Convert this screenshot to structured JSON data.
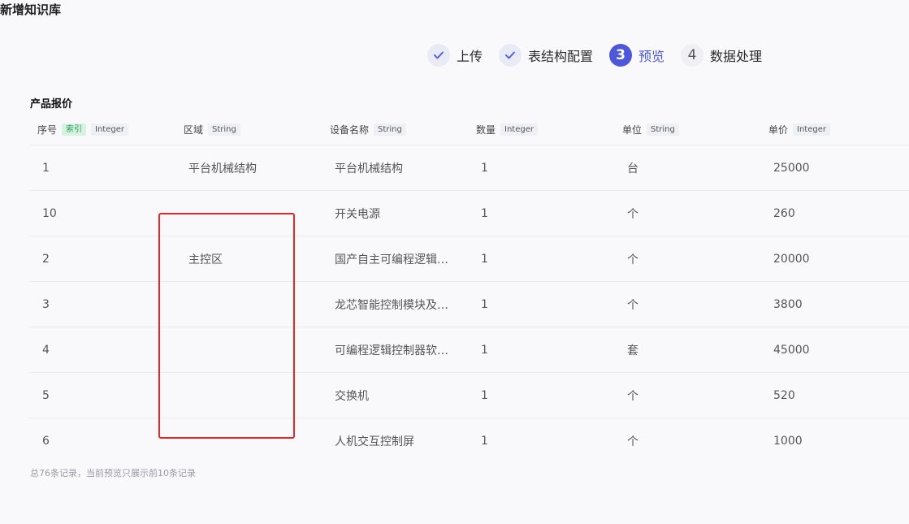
{
  "page_title": "新增知识库",
  "steps": [
    {
      "label": "上传",
      "status": "done",
      "marker": "✓"
    },
    {
      "label": "表结构配置",
      "status": "done",
      "marker": "✓"
    },
    {
      "label": "预览",
      "status": "active",
      "marker": "3"
    },
    {
      "label": "数据处理",
      "status": "todo",
      "marker": "4"
    }
  ],
  "table": {
    "title": "产品报价",
    "columns": [
      {
        "name": "序号",
        "index_tag": "索引",
        "type": "Integer"
      },
      {
        "name": "区域",
        "type": "String"
      },
      {
        "name": "设备名称",
        "type": "String"
      },
      {
        "name": "数量",
        "type": "Integer"
      },
      {
        "name": "单位",
        "type": "String"
      },
      {
        "name": "单价",
        "type": "Integer"
      }
    ],
    "rows": [
      [
        "1",
        "平台机械结构",
        "平台机械结构",
        "1",
        "台",
        "25000"
      ],
      [
        "10",
        "",
        "开关电源",
        "1",
        "个",
        "260"
      ],
      [
        "2",
        "主控区",
        "国产自主可编程逻辑…",
        "1",
        "个",
        "20000"
      ],
      [
        "3",
        "",
        "龙芯智能控制模块及…",
        "1",
        "个",
        "3800"
      ],
      [
        "4",
        "",
        "可编程逻辑控制器软…",
        "1",
        "套",
        "45000"
      ],
      [
        "5",
        "",
        "交换机",
        "1",
        "个",
        "520"
      ],
      [
        "6",
        "",
        "人机交互控制屏",
        "1",
        "个",
        "1000"
      ]
    ]
  },
  "footer_note": "总76条记录，当前预览只展示前10条记录",
  "colors": {
    "accent": "#4c57d9",
    "highlight": "#e02a2a",
    "index_tag": "#2f9e5d"
  }
}
